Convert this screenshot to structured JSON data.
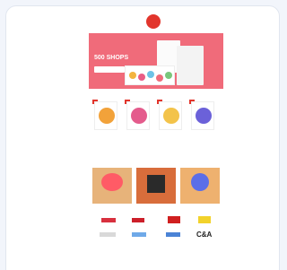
{
  "email": {
    "topbar": {
      "left_text": "",
      "right_text": ""
    },
    "logo_text": "",
    "hero": {
      "kicker": "",
      "headline": "500 SHOPS",
      "cta": "",
      "bg_color": "#f06b7a"
    },
    "sections": {
      "products_title": "",
      "tiles_title": "",
      "brands_title": "",
      "footer_title": ""
    },
    "products": [
      {
        "name": "",
        "price": "",
        "pop": "#f2a23a"
      },
      {
        "name": "",
        "price": "",
        "pop": "#e45b8c"
      },
      {
        "name": "",
        "price": "",
        "pop": "#f3c34a"
      },
      {
        "name": "",
        "price": "",
        "pop": "#6b61d9"
      }
    ],
    "tiles": [
      {
        "caption": "",
        "bg": "#e7b37a",
        "accent": "#ff5b66"
      },
      {
        "caption": "",
        "bg": "#d86d3b",
        "accent": "#2a2a2a"
      },
      {
        "caption": "",
        "bg": "#eeb16f",
        "accent": "#5b6ee8"
      }
    ],
    "brands": [
      {
        "name": "C&A",
        "color": "#222222"
      }
    ],
    "colors": {
      "accent": "#e2352c"
    }
  }
}
